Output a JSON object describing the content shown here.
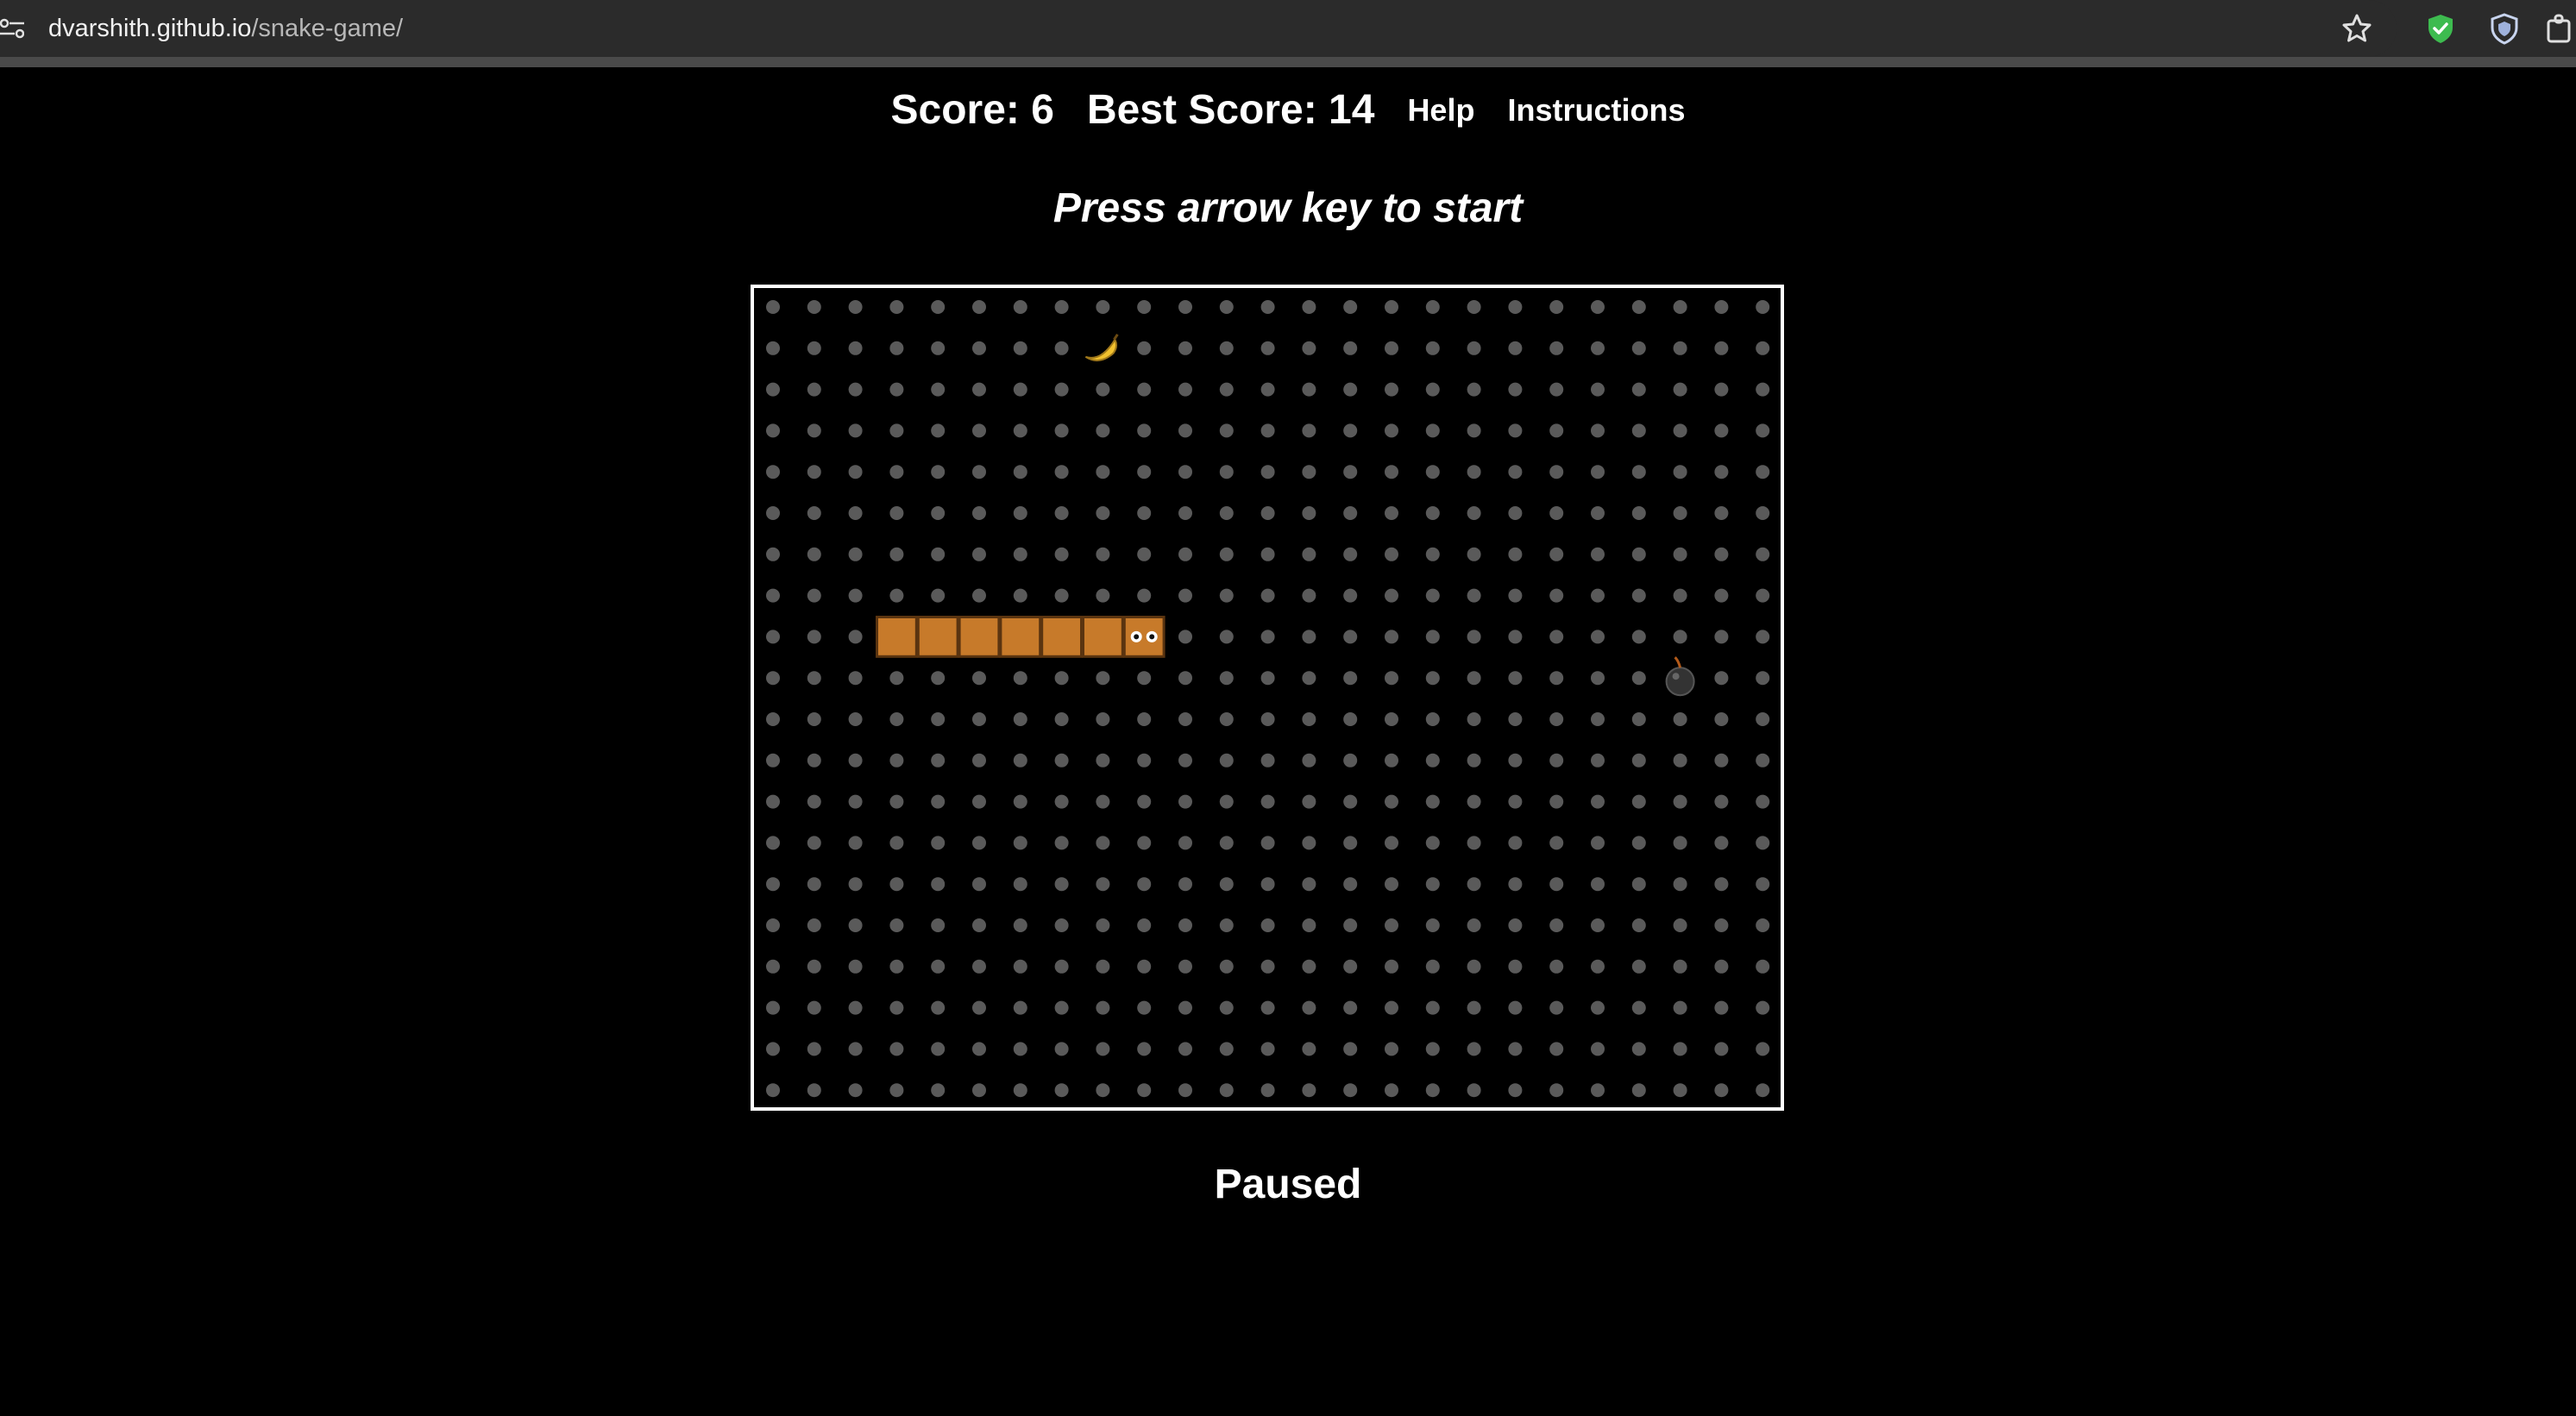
{
  "browser": {
    "url_host": "dvarshith.github.io",
    "url_path": "/snake-game/",
    "icons": [
      "site-info-icon",
      "bookmark-star-icon",
      "shield-check-icon",
      "privacy-shield-icon",
      "extensions-icon"
    ]
  },
  "header": {
    "score_text": "Score: 6",
    "best_score_text": "Best Score: 14",
    "help_label": "Help",
    "instructions_label": "Instructions"
  },
  "prompt": "Press arrow key to start",
  "status": "Paused",
  "game": {
    "grid_cols": 25,
    "grid_rows": 20,
    "snake": {
      "color": "#c77a2a",
      "direction": "right",
      "cells": [
        [
          3,
          8
        ],
        [
          4,
          8
        ],
        [
          5,
          8
        ],
        [
          6,
          8
        ],
        [
          7,
          8
        ],
        [
          8,
          8
        ],
        [
          9,
          8
        ]
      ]
    },
    "food": {
      "type": "banana",
      "col": 8,
      "row": 1,
      "color": "#f2c12e"
    },
    "bomb": {
      "col": 22,
      "row": 9,
      "color": "#333333"
    },
    "dot_color": "#5a5a5a",
    "border_color": "#ffffff"
  }
}
